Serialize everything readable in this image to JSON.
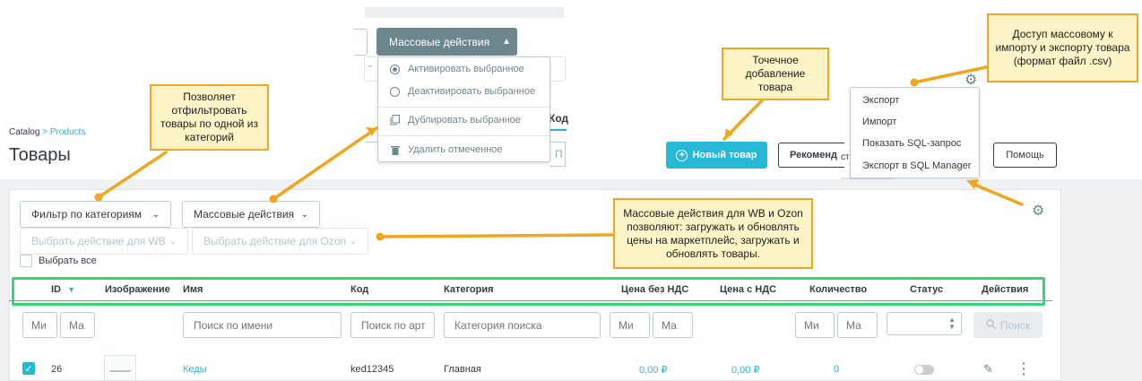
{
  "top": {
    "mass_button_label": "Массовые действия",
    "mass_menu": {
      "activate": "Активировать выбранное",
      "deactivate": "Деактивировать выбранное",
      "duplicate": "Дублировать выбранное",
      "delete": "Удалить отмеченное"
    },
    "ghost_code_header": "Код",
    "ghost_input_letter": "П"
  },
  "breadcrumb": {
    "root": "Catalog",
    "separator": ">",
    "current": "Products"
  },
  "page_title": "Товары",
  "header_buttons": {
    "new_product": "Новый товар",
    "recommended": "Рекоменд",
    "help": "Помощь",
    "ghost_text": "ст"
  },
  "export_menu": {
    "export": "Экспорт",
    "import": "Импорт",
    "show_sql": "Показать SQL-запрос",
    "export_sql_manager": "Экспорт в SQL Manager"
  },
  "toolbar": {
    "category_filter": "Фильтр по категориям",
    "mass_actions": "Массовые действия",
    "wb_action": "Выбрать действие для WB",
    "ozon_action": "Выбрать действие для Ozon",
    "select_all": "Выбрать все"
  },
  "table": {
    "headers": {
      "id": "ID",
      "image": "Изображение",
      "name": "Имя",
      "code": "Код",
      "category": "Категория",
      "price_no_vat": "Цена без НДС",
      "price_vat": "Цена с НДС",
      "quantity": "Количество",
      "status": "Статус",
      "actions": "Действия"
    },
    "filters": {
      "id_min": "Ми",
      "id_max": "Ма",
      "name": "Поиск по имени",
      "code": "Поиск по арт",
      "category": "Категория поиска",
      "price_min": "Ми",
      "price_max": "Ма",
      "qty_min": "Ми",
      "qty_max": "Ма",
      "search_button": "Поиск"
    },
    "rows": [
      {
        "id": "26",
        "name": "Кеды",
        "code": "ked12345",
        "category": "Главная",
        "price_no_vat": "0,00 ₽",
        "price_vat": "0,00 ₽",
        "quantity": "0",
        "status_enabled": false,
        "checked": true
      }
    ]
  },
  "callouts": {
    "filter_note": "Позволяет отфильтровать товары по одной из категорий",
    "add_note": "Точечное добавление товара",
    "import_note": "Доступ массовому к импорту и экспорту товара (формат файл .csv)",
    "mass_note": "Массовые действия для WB и Ozon позволяют: загружать и обновлять цены на маркетплейс, загружать и обновлять товары."
  },
  "colors": {
    "accent": "#25b9d7",
    "callout_fill": "#fcf3c7",
    "callout_border": "#f0a61e",
    "highlight_box": "#36d676"
  },
  "icons": {
    "search": "search-icon",
    "gear": "gear-icon",
    "plus": "plus-circle-icon",
    "edit": "pencil-icon",
    "more": "dots-vertical-icon"
  }
}
